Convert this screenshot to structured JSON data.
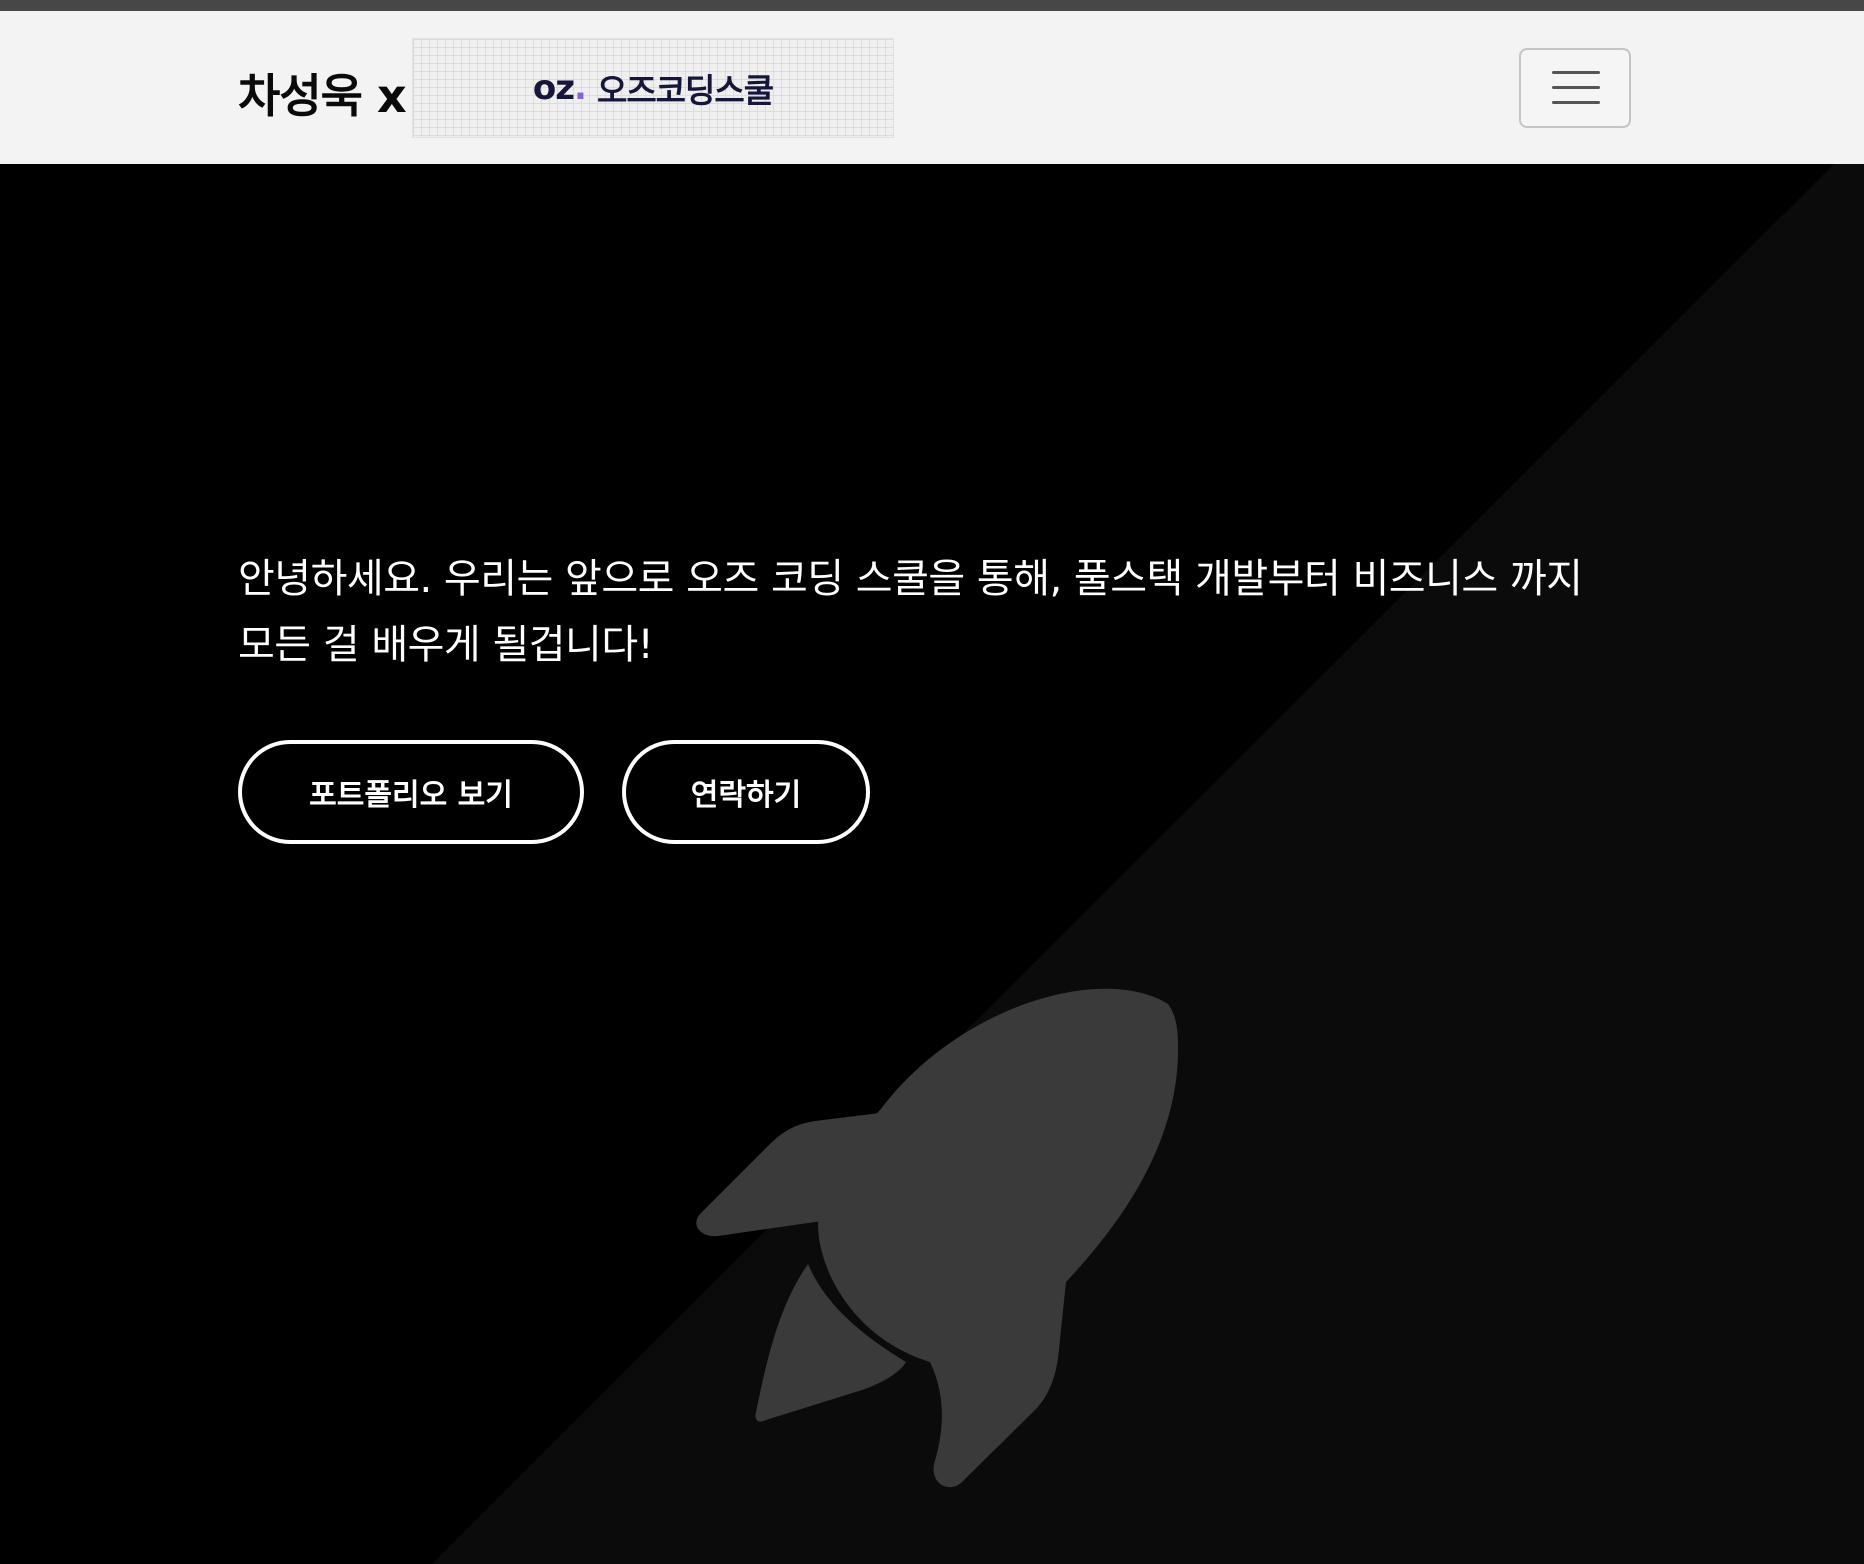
{
  "header": {
    "brand": "차성욱 x",
    "logo_mark": "oz",
    "logo_dot": ".",
    "logo_text": "오즈코딩스쿨",
    "menu_toggle_icon": "hamburger-icon"
  },
  "hero": {
    "text": "안녕하세요. 우리는 앞으로 오즈 코딩 스쿨을 통해, 풀스택 개발부터 비즈니스 까지 모든 걸 배우게 될겁니다!",
    "buttons": {
      "portfolio": "포트폴리오 보기",
      "contact": "연락하기"
    },
    "illustration_icon": "rocket-icon"
  },
  "colors": {
    "navbar_bg": "#f3f3f3",
    "hero_bg": "#000000",
    "diagonal_bg": "#0b0b0b",
    "rocket": "#3a3a3a",
    "logo_accent": "#8a63d2"
  }
}
